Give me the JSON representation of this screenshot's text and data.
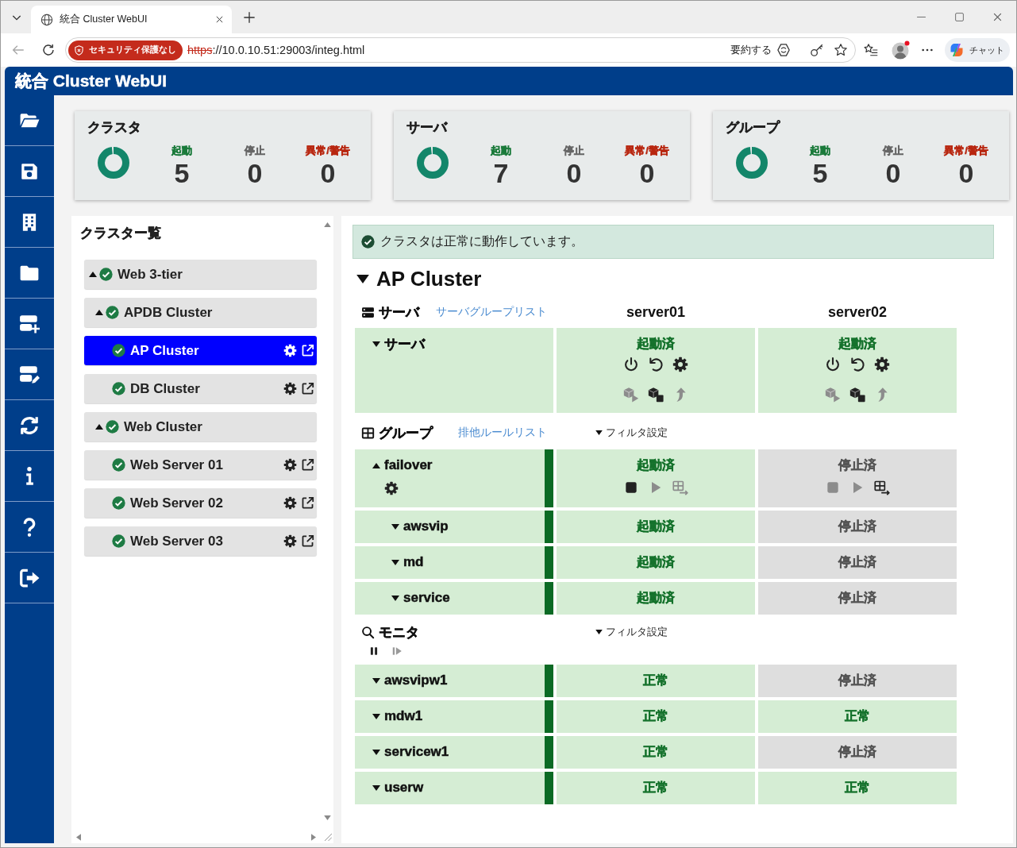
{
  "browser": {
    "tab_title": "統合 Cluster WebUI",
    "security_label": "セキュリティ保護なし",
    "url_scheme": "https",
    "url_rest": "://10.0.10.51:29003/integ.html",
    "summarize_label": "要約する",
    "chat_label": "チャット"
  },
  "app": {
    "title": "統合 Cluster WebUI"
  },
  "summary_cards": [
    {
      "title": "クラスタ",
      "stats": [
        {
          "kind": "running",
          "label": "起動",
          "value": "5"
        },
        {
          "kind": "stopped",
          "label": "停止",
          "value": "0"
        },
        {
          "kind": "error",
          "label": "異常/警告",
          "value": "0"
        }
      ]
    },
    {
      "title": "サーバ",
      "stats": [
        {
          "kind": "running",
          "label": "起動",
          "value": "7"
        },
        {
          "kind": "stopped",
          "label": "停止",
          "value": "0"
        },
        {
          "kind": "error",
          "label": "異常/警告",
          "value": "0"
        }
      ]
    },
    {
      "title": "グループ",
      "stats": [
        {
          "kind": "running",
          "label": "起動",
          "value": "5"
        },
        {
          "kind": "stopped",
          "label": "停止",
          "value": "0"
        },
        {
          "kind": "error",
          "label": "異常/警告",
          "value": "0"
        }
      ]
    }
  ],
  "cluster_list": {
    "title": "クラスター覧",
    "items": [
      {
        "name": "Web 3-tier",
        "ok": true,
        "selected": false,
        "expanded": true,
        "children": [
          {
            "name": "APDB Cluster",
            "ok": true,
            "selected": false,
            "expanded": true,
            "children": [
              {
                "name": "AP Cluster",
                "ok": true,
                "selected": true
              },
              {
                "name": "DB Cluster",
                "ok": true,
                "selected": false
              }
            ]
          },
          {
            "name": "Web Cluster",
            "ok": true,
            "selected": false,
            "expanded": true,
            "children": [
              {
                "name": "Web Server 01",
                "ok": true,
                "selected": false
              },
              {
                "name": "Web Server 02",
                "ok": true,
                "selected": false
              },
              {
                "name": "Web Server 03",
                "ok": true,
                "selected": false
              }
            ]
          }
        ]
      }
    ]
  },
  "detail": {
    "alert": {
      "kind": "success",
      "text": "クラスタは正常に動作しています。"
    },
    "title": "AP Cluster",
    "expanded": true,
    "servers": {
      "title": "サーバ",
      "link": "サーバグループリスト",
      "columns": [
        "server01",
        "server02"
      ],
      "rows": [
        {
          "name": "サーバ",
          "expanded": false,
          "cells": [
            {
              "active": true,
              "text": "起動済",
              "action_rows": [
                [
                  {
                    "kind": "power",
                    "disabled": false
                  },
                  {
                    "kind": "restart",
                    "disabled": false
                  },
                  {
                    "kind": "settings",
                    "disabled": false
                  }
                ],
                [
                  {
                    "kind": "cube_start",
                    "disabled": true
                  },
                  {
                    "kind": "cube_stop",
                    "disabled": false
                  },
                  {
                    "kind": "upload",
                    "disabled": true
                  }
                ]
              ]
            },
            {
              "active": true,
              "text": "起動済",
              "action_rows": [
                [
                  {
                    "kind": "power",
                    "disabled": false
                  },
                  {
                    "kind": "restart",
                    "disabled": false
                  },
                  {
                    "kind": "settings",
                    "disabled": false
                  }
                ],
                [
                  {
                    "kind": "cube_start",
                    "disabled": true
                  },
                  {
                    "kind": "cube_stop",
                    "disabled": false
                  },
                  {
                    "kind": "upload",
                    "disabled": true
                  }
                ]
              ]
            }
          ]
        }
      ]
    },
    "groups": {
      "title": "グループ",
      "link": "排他ルールリスト",
      "filter": "フィルタ設定",
      "rows": [
        {
          "name": "failover",
          "ok": true,
          "expanded": true,
          "settings_button": true,
          "cells": [
            {
              "active": true,
              "text": "起動済",
              "action_rows": [
                [
                  {
                    "kind": "stop",
                    "disabled": false
                  },
                  {
                    "kind": "start",
                    "disabled": true
                  },
                  {
                    "kind": "move",
                    "disabled": true
                  }
                ]
              ]
            },
            {
              "active": false,
              "text": "停止済",
              "action_rows": [
                [
                  {
                    "kind": "stop",
                    "disabled": true
                  },
                  {
                    "kind": "start",
                    "disabled": true
                  },
                  {
                    "kind": "move",
                    "disabled": false
                  }
                ]
              ]
            }
          ],
          "children": [
            {
              "name": "awsvip",
              "ok": true,
              "expanded": false,
              "cells": [
                {
                  "active": true,
                  "text": "起動済"
                },
                {
                  "active": false,
                  "text": "停止済"
                }
              ]
            },
            {
              "name": "md",
              "ok": true,
              "expanded": false,
              "cells": [
                {
                  "active": true,
                  "text": "起動済"
                },
                {
                  "active": false,
                  "text": "停止済"
                }
              ]
            },
            {
              "name": "service",
              "ok": true,
              "expanded": false,
              "cells": [
                {
                  "active": true,
                  "text": "起動済"
                },
                {
                  "active": false,
                  "text": "停止済"
                }
              ]
            }
          ]
        }
      ]
    },
    "monitors": {
      "title": "モニタ",
      "filter": "フィルタ設定",
      "controls": [
        {
          "kind": "pause",
          "disabled": false
        },
        {
          "kind": "resume",
          "disabled": true
        }
      ],
      "rows": [
        {
          "name": "awsvipw1",
          "ok": true,
          "expanded": false,
          "cells": [
            {
              "active": true,
              "text": "正常"
            },
            {
              "active": false,
              "text": "停止済"
            }
          ]
        },
        {
          "name": "mdw1",
          "ok": true,
          "expanded": false,
          "cells": [
            {
              "active": true,
              "text": "正常"
            },
            {
              "active": true,
              "text": "正常"
            }
          ]
        },
        {
          "name": "servicew1",
          "ok": true,
          "expanded": false,
          "cells": [
            {
              "active": true,
              "text": "正常"
            },
            {
              "active": false,
              "text": "停止済"
            }
          ]
        },
        {
          "name": "userw",
          "ok": true,
          "expanded": false,
          "cells": [
            {
              "active": true,
              "text": "正常"
            },
            {
              "active": true,
              "text": "正常"
            }
          ]
        }
      ]
    }
  }
}
